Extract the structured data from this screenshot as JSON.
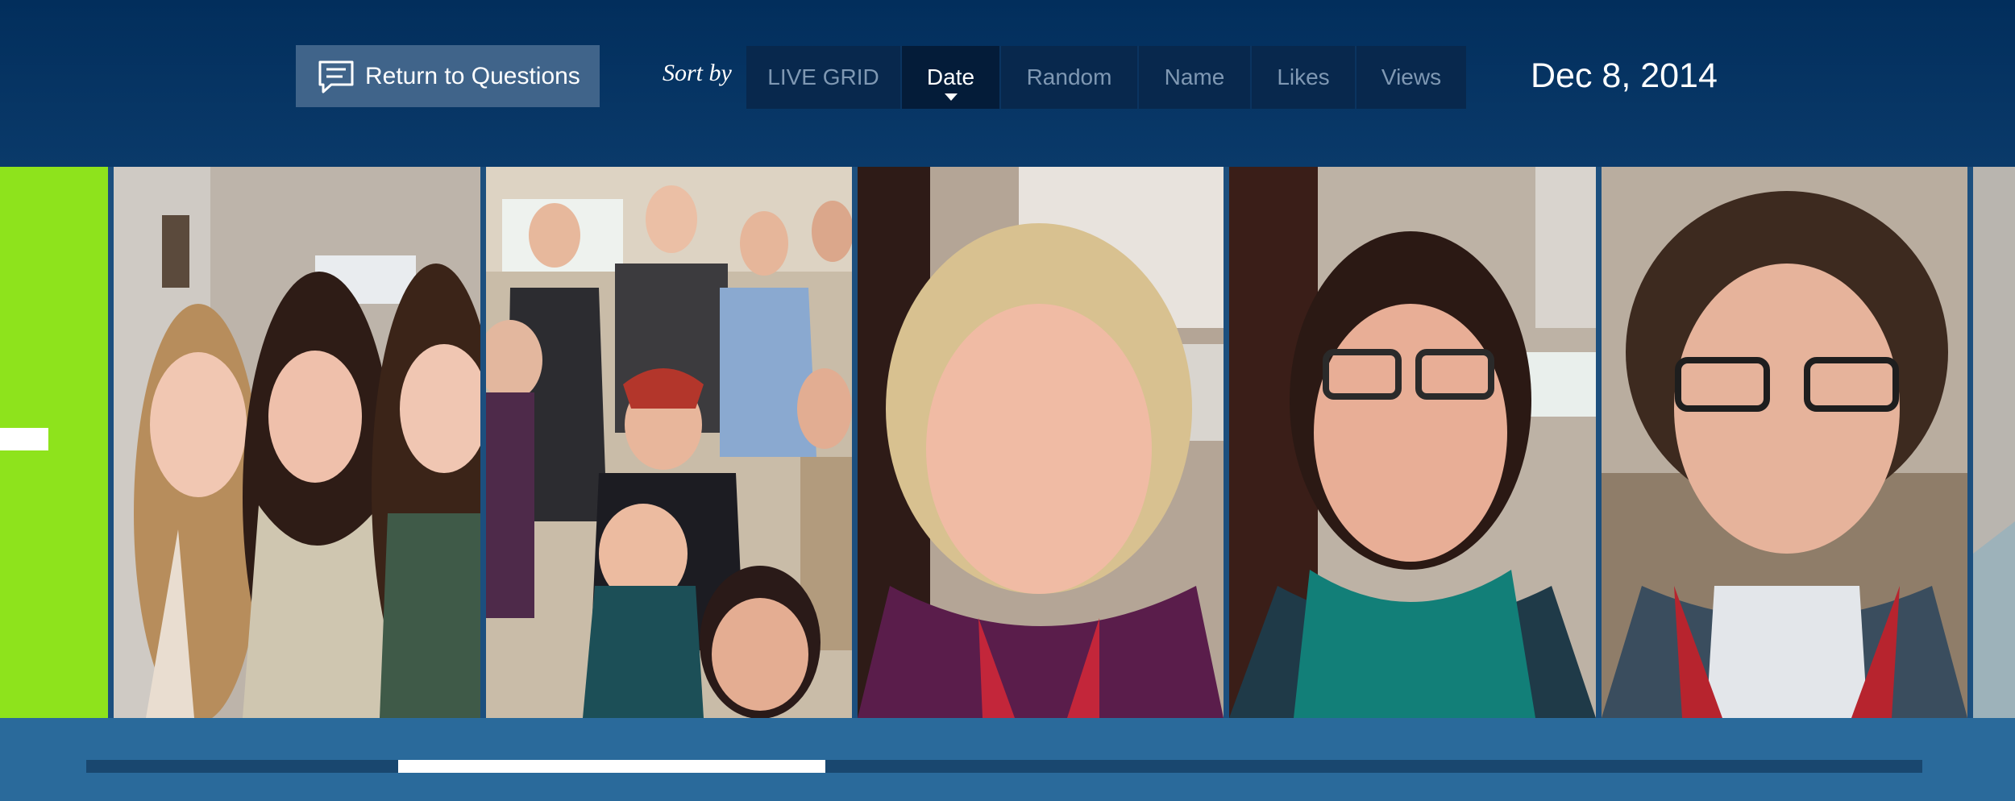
{
  "toolbar": {
    "return_label": "Return to Questions",
    "return_icon": "comment-icon",
    "sort_label": "Sort by",
    "sort_options": [
      "LIVE GRID",
      "Date",
      "Random",
      "Name",
      "Likes",
      "Views"
    ],
    "selected_sort": "Date",
    "date": "Dec 8, 2014"
  },
  "photos": [
    {
      "name": "photo-1",
      "desc": "three women selfie"
    },
    {
      "name": "photo-2",
      "desc": "group photo"
    },
    {
      "name": "photo-3",
      "desc": "woman with purple scarf"
    },
    {
      "name": "photo-4",
      "desc": "woman with glasses and teal scarf"
    },
    {
      "name": "photo-5",
      "desc": "man with curly hair and glasses"
    }
  ],
  "scrollbar": {
    "position_fraction": 0.17,
    "visible_fraction": 0.23
  },
  "colors": {
    "background": "#0c3560",
    "accent_green": "#8ee31c",
    "button": "#40648a",
    "sort_bar": "#08284d"
  }
}
